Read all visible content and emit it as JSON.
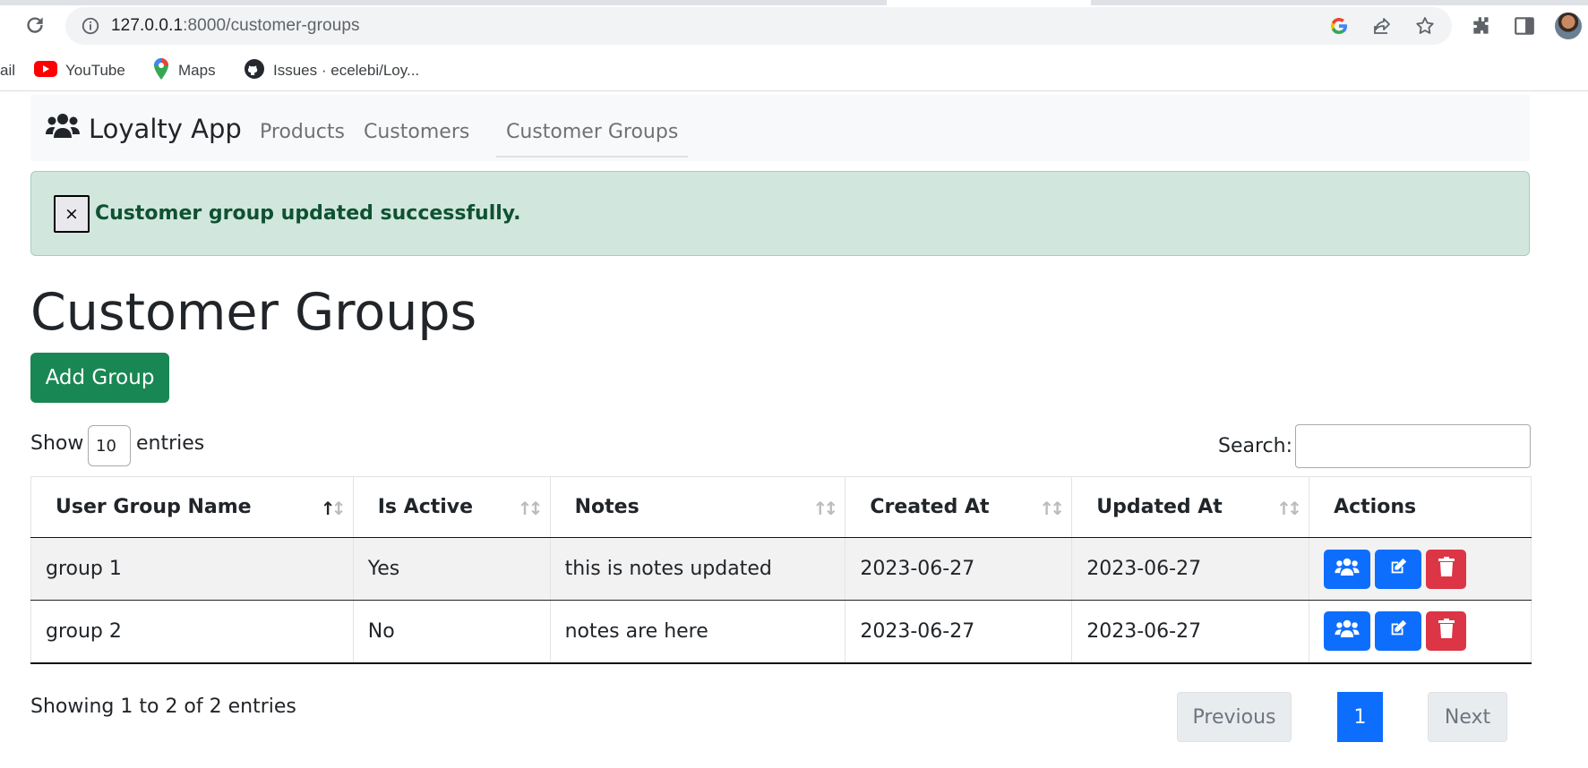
{
  "browser": {
    "url_host": "127.0.0.1",
    "url_path": ":8000/customer-groups",
    "bookmarks": [
      {
        "label": "ail",
        "icon": "gmail-icon"
      },
      {
        "label": "YouTube",
        "icon": "youtube-icon"
      },
      {
        "label": "Maps",
        "icon": "maps-icon"
      },
      {
        "label": "Issues · ecelebi/Loy...",
        "icon": "github-icon"
      }
    ]
  },
  "navbar": {
    "brand": "Loyalty App",
    "links": [
      "Products",
      "Customers",
      "Customer Groups"
    ],
    "active": "Customer Groups"
  },
  "alert": {
    "close": "×",
    "message": "Customer group updated successfully."
  },
  "page": {
    "title": "Customer Groups",
    "add_button": "Add Group"
  },
  "table_controls": {
    "show_label": "Show",
    "page_length": "10",
    "entries_label": "entries",
    "search_label": "Search:",
    "search_value": ""
  },
  "table": {
    "columns": [
      "User Group Name",
      "Is Active",
      "Notes",
      "Created At",
      "Updated At",
      "Actions"
    ],
    "sorted_column": "User Group Name",
    "rows": [
      {
        "name": "group 1",
        "active": "Yes",
        "notes": "this is notes updated",
        "created": "2023-06-27",
        "updated": "2023-06-27"
      },
      {
        "name": "group 2",
        "active": "No",
        "notes": "notes are here",
        "created": "2023-06-27",
        "updated": "2023-06-27"
      }
    ]
  },
  "footer": {
    "info": "Showing 1 to 2 of 2 entries",
    "previous": "Previous",
    "current_page": "1",
    "next": "Next"
  },
  "colors": {
    "primary": "#0d6efd",
    "success": "#198754",
    "danger": "#dc3545",
    "alert_bg": "#d1e7dd",
    "alert_text": "#0f5132"
  }
}
